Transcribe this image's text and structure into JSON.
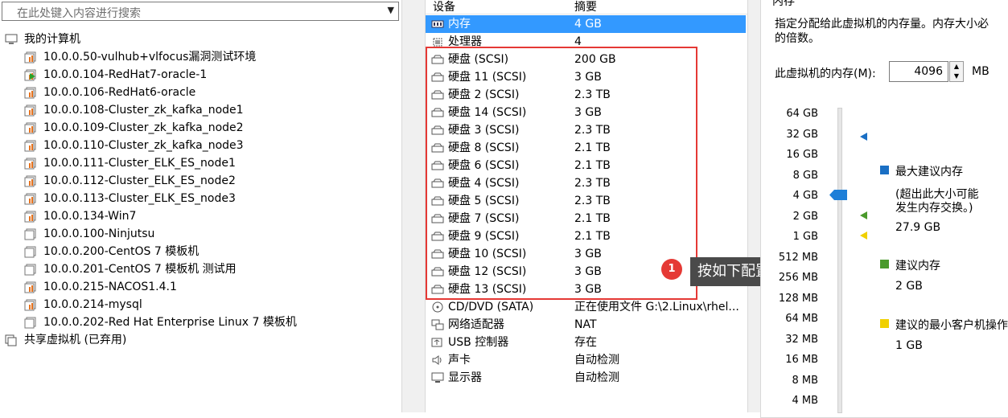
{
  "library": {
    "search_placeholder": "在此处键入内容进行搜索",
    "root": "我的计算机",
    "vms": [
      "10.0.0.50-vulhub+vlfocus漏洞测试环境",
      "10.0.0.104-RedHat7-oracle-1",
      "10.0.0.106-RedHat6-oracle",
      "10.0.0.108-Cluster_zk_kafka_node1",
      "10.0.0.109-Cluster_zk_kafka_node2",
      "10.0.0.110-Cluster_zk_kafka_node3",
      "10.0.0.111-Cluster_ELK_ES_node1",
      "10.0.0.112-Cluster_ELK_ES_node2",
      "10.0.0.113-Cluster_ELK_ES_node3",
      "10.0.0.134-Win7",
      "10.0.0.100-Ninjutsu",
      "10.0.0.200-CentOS 7 模板机",
      "10.0.0.201-CentOS 7 模板机 测试用",
      "10.0.0.215-NACOS1.4.1",
      "10.0.0.214-mysql",
      "10.0.0.202-Red Hat Enterprise Linux 7 模板机"
    ],
    "shared": "共享虚拟机 (已弃用)"
  },
  "devices": {
    "col_device": "设备",
    "col_summary": "摘要",
    "rows": [
      {
        "name": "内存",
        "summary": "4 GB"
      },
      {
        "name": "处理器",
        "summary": "4"
      },
      {
        "name": "硬盘 (SCSI)",
        "summary": "200 GB"
      },
      {
        "name": "硬盘 11 (SCSI)",
        "summary": "3 GB"
      },
      {
        "name": "硬盘 2 (SCSI)",
        "summary": "2.3 TB"
      },
      {
        "name": "硬盘 14 (SCSI)",
        "summary": "3 GB"
      },
      {
        "name": "硬盘 3 (SCSI)",
        "summary": "2.3 TB"
      },
      {
        "name": "硬盘 8 (SCSI)",
        "summary": "2.1 TB"
      },
      {
        "name": "硬盘 6 (SCSI)",
        "summary": "2.1 TB"
      },
      {
        "name": "硬盘 4 (SCSI)",
        "summary": "2.3 TB"
      },
      {
        "name": "硬盘 5 (SCSI)",
        "summary": "2.3 TB"
      },
      {
        "name": "硬盘 7 (SCSI)",
        "summary": "2.1 TB"
      },
      {
        "name": "硬盘 9 (SCSI)",
        "summary": "2.1 TB"
      },
      {
        "name": "硬盘 10 (SCSI)",
        "summary": "3 GB"
      },
      {
        "name": "硬盘 12 (SCSI)",
        "summary": "3 GB"
      },
      {
        "name": "硬盘 13 (SCSI)",
        "summary": "3 GB"
      },
      {
        "name": "CD/DVD (SATA)",
        "summary": "正在使用文件 G:\\2.Linux\\rhel..."
      },
      {
        "name": "网络适配器",
        "summary": "NAT"
      },
      {
        "name": "USB 控制器",
        "summary": "存在"
      },
      {
        "name": "声卡",
        "summary": "自动检测"
      },
      {
        "name": "显示器",
        "summary": "自动检测"
      }
    ]
  },
  "callout": {
    "number": "1",
    "text": "按如下配置添加硬盘"
  },
  "memory": {
    "group_title": "内存",
    "desc_line1": "指定分配给此虚拟机的内存量。内存大小必",
    "desc_line2": "的倍数。",
    "field_label": "此虚拟机的内存(M):",
    "value": "4096",
    "unit": "MB",
    "ticks": [
      "64 GB",
      "32 GB",
      "16 GB",
      "8 GB",
      "4 GB",
      "2 GB",
      "1 GB",
      "512 MB",
      "256 MB",
      "128 MB",
      "64 MB",
      "32 MB",
      "16 MB",
      "8 MB",
      "4 MB"
    ],
    "max_label": "最大建议内存",
    "max_note1": "(超出此大小可能",
    "max_note2": "发生内存交换。)",
    "max_value": "27.9 GB",
    "rec_label": "建议内存",
    "rec_value": "2 GB",
    "min_label": "建议的最小客户机操作",
    "min_value": "1 GB"
  },
  "colors": {
    "selected": "#3399ff",
    "highlight": "#e53935",
    "max": "#1a6fc4",
    "rec": "#4a9a2c",
    "min": "#f0d000"
  }
}
